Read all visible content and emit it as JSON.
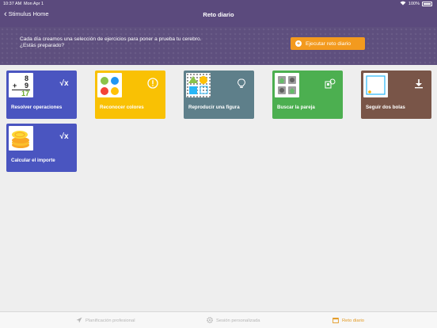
{
  "status_bar": {
    "time": "10:37 AM",
    "date": "Mon Apr 1",
    "battery": "100%"
  },
  "nav": {
    "back_label": "Stimulus Home",
    "title": "Reto diario"
  },
  "banner": {
    "line1": "Cada día creamos una selección de ejercicios para poner a prueba tu cerebro.",
    "line2": "¿Estás preparado?",
    "button_label": "Ejecutar reto diario"
  },
  "cards": [
    {
      "label": "Resolver operaciones",
      "icon": "square-root-icon",
      "color": "#4a55c0"
    },
    {
      "label": "Reconocer colores",
      "icon": "alert-circle-icon",
      "color": "#f9c104"
    },
    {
      "label": "Reproducir una figura",
      "icon": "lightbulb-icon",
      "color": "#5e7f8a"
    },
    {
      "label": "Buscar la pareja",
      "icon": "memory-cards-icon",
      "color": "#4caf50"
    },
    {
      "label": "Seguir dos bolas",
      "icon": "download-icon",
      "color": "#795548"
    },
    {
      "label": "Calcular el importe",
      "icon": "square-root-icon",
      "color": "#4a55c0"
    }
  ],
  "thumbs": {
    "operation": {
      "a": "8",
      "op": "+",
      "b": "9",
      "result": "17"
    }
  },
  "tabs": [
    {
      "label": "Planificación profesional",
      "icon": "rocket-icon",
      "active": false
    },
    {
      "label": "Sesión personalizada",
      "icon": "gear-icon",
      "active": false
    },
    {
      "label": "Reto diario",
      "icon": "calendar-icon",
      "active": true
    }
  ],
  "colors": {
    "header": "#5b4a7d",
    "accent": "#f39a1e",
    "tab_active": "#e39a24"
  }
}
